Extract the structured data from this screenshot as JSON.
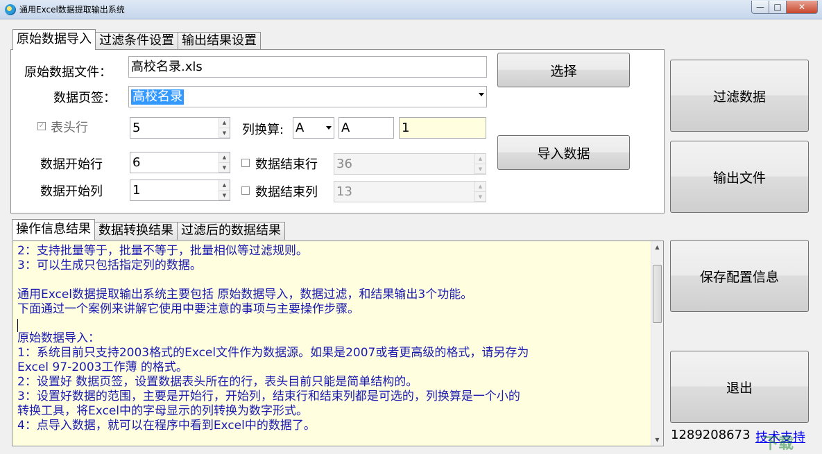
{
  "window": {
    "title": "通用Excel数据提取输出系统",
    "min": "0",
    "max": "1",
    "close": "r"
  },
  "top_tabs": [
    "原始数据导入",
    "过滤条件设置",
    "输出结果设置"
  ],
  "import": {
    "file_label": "原始数据文件：",
    "file_value": "高校名录.xls",
    "select_button": "选择",
    "sheet_label": "数据页签：",
    "sheet_value": "高校名录",
    "header_label": "表头行",
    "header_value": "5",
    "col_calc_label": "列换算:",
    "col_calc_combo": "A",
    "col_calc_input": "A",
    "col_calc_result": "1",
    "import_button": "导入数据",
    "start_row_label": "数据开始行",
    "start_row_value": "6",
    "end_row_label": "数据结束行",
    "end_row_value": "36",
    "start_col_label": "数据开始列",
    "start_col_value": "1",
    "end_col_label": "数据结束列",
    "end_col_value": "13"
  },
  "bottom_tabs": [
    "操作信息结果",
    "数据转换结果",
    "过滤后的数据结果"
  ],
  "log_lines": [
    "2：支持批量等于，批量不等于，批量相似等过滤规则。",
    "3：可以生成只包括指定列的数据。",
    "",
    "通用Excel数据提取输出系统主要包括 原始数据导入，数据过滤，和结果输出3个功能。",
    "下面通过一个案例来讲解它使用中要注意的事项与主要操作步骤。",
    "",
    "原始数据导入：",
    "1：系统目前只支持2003格式的Excel文件作为数据源。如果是2007或者更高级的格式，请另存为",
    "Excel 97-2003工作薄 的格式。",
    "2：设置好 数据页签，设置数据表头所在的行，表头目前只能是简单结构的。",
    "3：设置好数据的范围，主要是开始行，开始列，结束行和结束列都是可选的，列换算是一个小的",
    "转换工具，将Excel中的字母显示的列转换为数字形式。",
    "4：点导入数据，就可以在程序中看到Excel中的数据了。"
  ],
  "side_buttons": {
    "filter": "过滤数据",
    "output": "输出文件",
    "save_config": "保存配置信息",
    "exit": "退出"
  },
  "footer": {
    "phone": "1289208673",
    "support_link": "技术支持",
    "watermark": "下载"
  }
}
